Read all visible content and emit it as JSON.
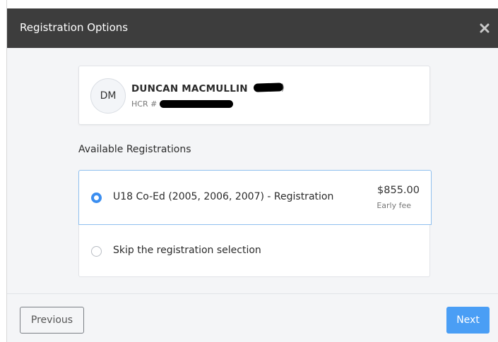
{
  "modal": {
    "title": "Registration Options",
    "close_icon": "close-icon"
  },
  "player": {
    "initials": "DM",
    "name": "DUNCAN MACMULLIN",
    "name_suffix": ")",
    "hcr_label": "HCR #"
  },
  "registrations": {
    "heading": "Available Registrations",
    "options": [
      {
        "label": "U18 Co-Ed (2005, 2006, 2007) - Registration",
        "price": "$855.00",
        "fee_note": "Early fee",
        "selected": true
      },
      {
        "label": "Skip the registration selection",
        "selected": false
      }
    ]
  },
  "footer": {
    "previous_label": "Previous",
    "next_label": "Next"
  },
  "colors": {
    "header_bg": "#3d3d3d",
    "accent": "#3b8ef0",
    "next_button": "#4a9ef5",
    "selected_border": "#8fbfee"
  }
}
